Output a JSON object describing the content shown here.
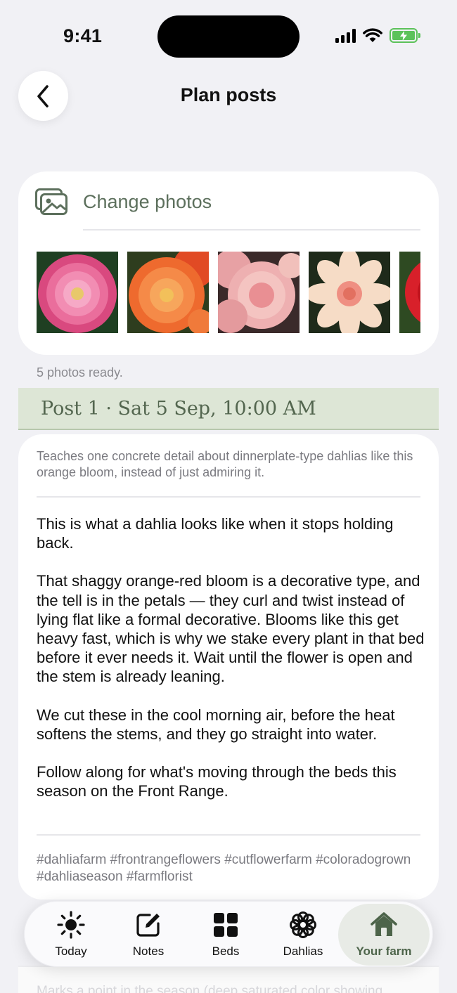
{
  "status_bar": {
    "time": "9:41",
    "icons": [
      "cellular-signal-icon",
      "wifi-icon",
      "battery-charging-icon"
    ],
    "battery_color": "#5cc25a"
  },
  "header": {
    "back_icon": "chevron-left-icon",
    "title": "Plan posts"
  },
  "photos_card": {
    "icon": "photos-icon",
    "change_label": "Change photos",
    "photos": [
      {
        "name": "pink-dahlia",
        "accent": "#e86b9a"
      },
      {
        "name": "orange-dahlia",
        "accent": "#f07a3a"
      },
      {
        "name": "peach-cafe-au-lait-dahlia",
        "accent": "#f2b2b0"
      },
      {
        "name": "cream-single-dahlia",
        "accent": "#f6d9c2"
      },
      {
        "name": "red-dahlia",
        "accent": "#d8202a"
      }
    ],
    "status": "5 photos ready."
  },
  "post": {
    "header": "Post 1 · Sat 5 Sep, 10:00 AM",
    "rationale": "Teaches one concrete detail about dinnerplate-type dahlias like this orange bloom, instead of just admiring it.",
    "paragraphs": [
      "This is what a dahlia looks like when it stops holding back.",
      "That shaggy orange-red bloom is a decorative type, and the tell is in the petals — they curl and twist instead of lying flat like a formal decorative. Blooms like this get heavy fast, which is why we stake every plant in that bed before it ever needs it. Wait until the flower is open and the stem is already leaning.",
      "We cut these in the cool morning air, before the heat softens the stems, and they go straight into water.",
      "Follow along for what's moving through the beds this season on the Front Range."
    ],
    "hashtags": "#dahliafarm #frontrangeflowers #cutflowerfarm #coloradogrown #dahliaseason #farmflorist"
  },
  "next_post": {
    "preview": "Marks a point in the season (deep saturated color showing"
  },
  "tab_bar": {
    "active_color": "#4d644a",
    "items": [
      {
        "label": "Today",
        "icon": "sun-icon",
        "active": false
      },
      {
        "label": "Notes",
        "icon": "compose-icon",
        "active": false
      },
      {
        "label": "Beds",
        "icon": "grid-icon",
        "active": false
      },
      {
        "label": "Dahlias",
        "icon": "flower-icon",
        "active": false
      },
      {
        "label": "Your farm",
        "icon": "house-icon",
        "active": true
      }
    ]
  }
}
